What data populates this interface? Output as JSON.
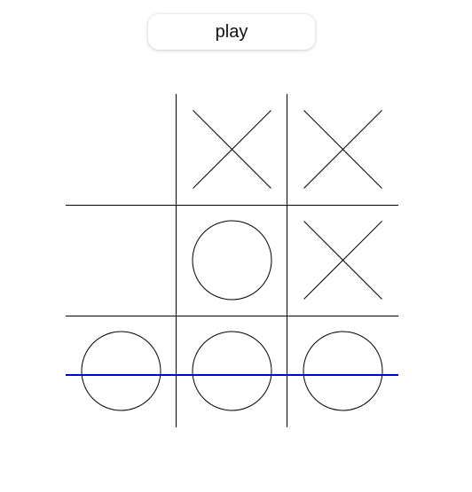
{
  "play_button": {
    "label": "play"
  },
  "board": {
    "cells": [
      "",
      "X",
      "X",
      "",
      "O",
      "X",
      "O",
      "O",
      "O"
    ],
    "winning_line": {
      "orientation": "row",
      "index": 2,
      "color": "#0000cc"
    },
    "line_color": "#000000"
  }
}
